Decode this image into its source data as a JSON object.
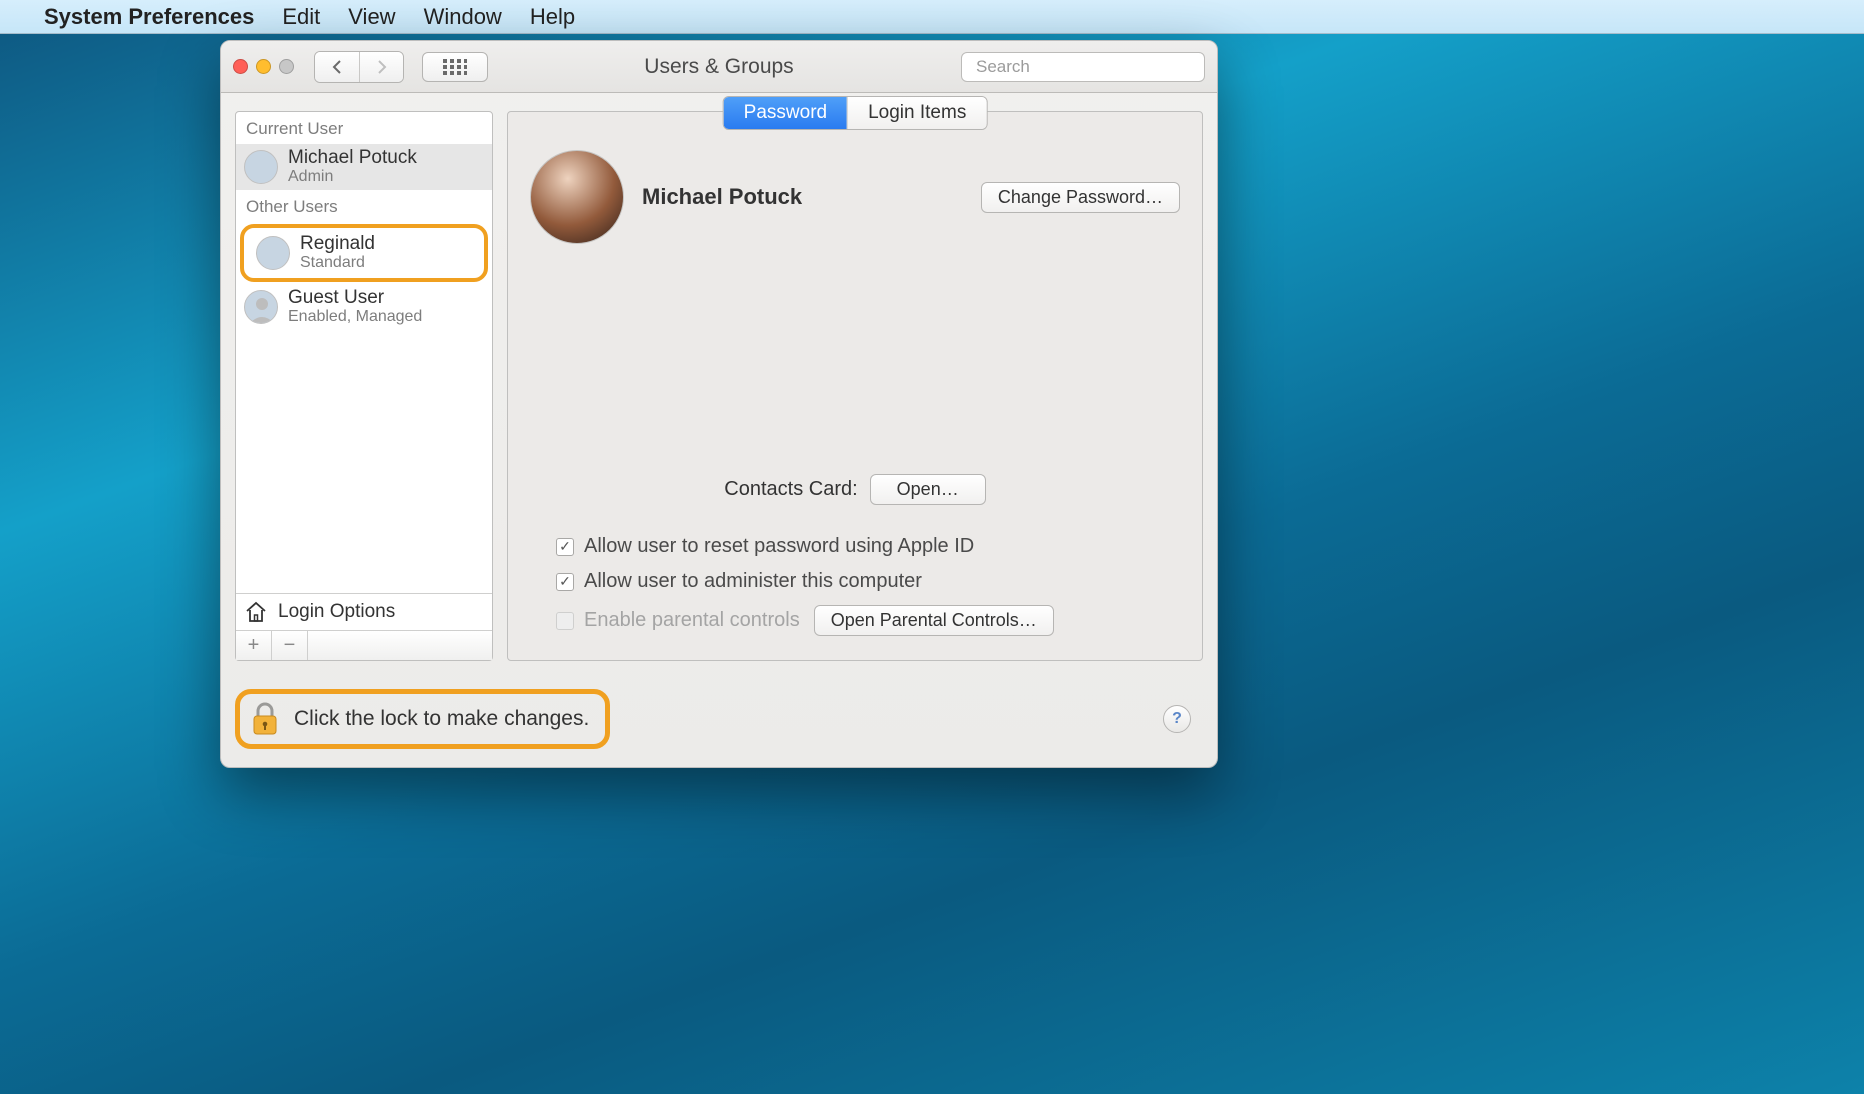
{
  "menubar": {
    "app": "System Preferences",
    "items": [
      "Edit",
      "View",
      "Window",
      "Help"
    ]
  },
  "window": {
    "title": "Users & Groups",
    "search_placeholder": "Search"
  },
  "sidebar": {
    "current_label": "Current User",
    "other_label": "Other Users",
    "current": {
      "name": "Michael Potuck",
      "role": "Admin"
    },
    "others": [
      {
        "name": "Reginald",
        "role": "Standard"
      },
      {
        "name": "Guest User",
        "role": "Enabled, Managed"
      }
    ],
    "login_options": "Login Options"
  },
  "tabs": {
    "password": "Password",
    "login_items": "Login Items"
  },
  "panel": {
    "name": "Michael Potuck",
    "change_password": "Change Password…",
    "contacts_label": "Contacts Card:",
    "open": "Open…",
    "allow_reset": "Allow user to reset password using Apple ID",
    "allow_admin": "Allow user to administer this computer",
    "parental": "Enable parental controls",
    "open_parental": "Open Parental Controls…"
  },
  "footer": {
    "lock_text": "Click the lock to make changes."
  }
}
